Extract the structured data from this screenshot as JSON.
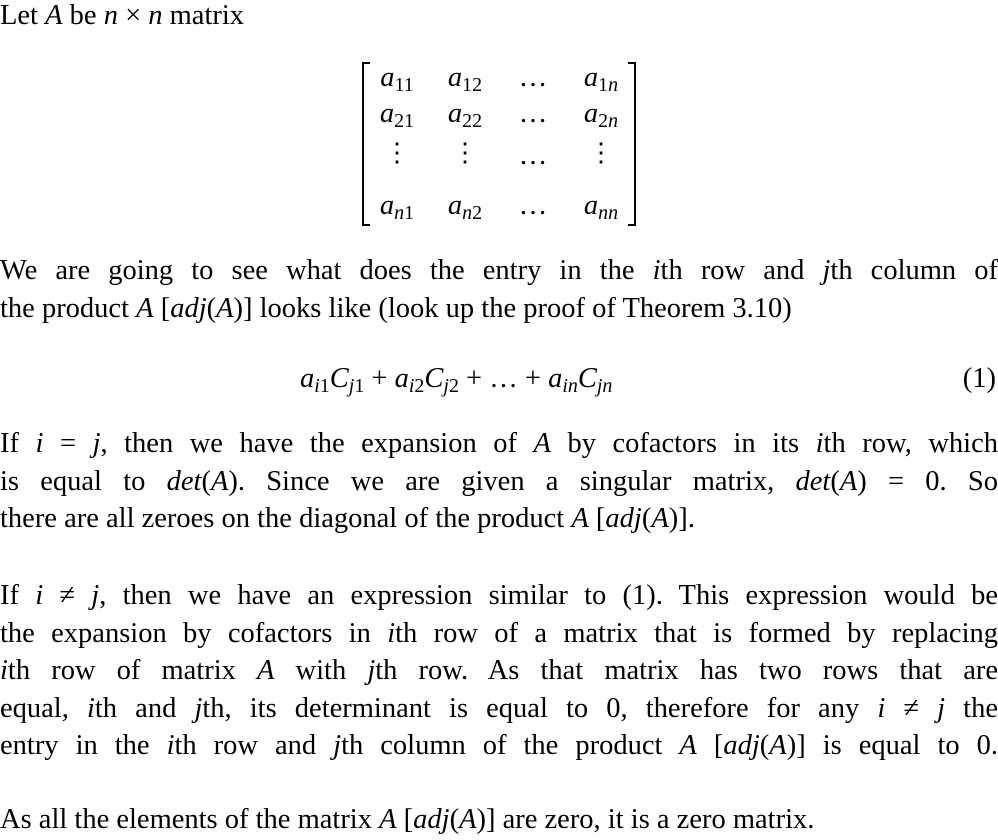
{
  "intro": [
    {
      "t": "Let ",
      "i": false
    },
    {
      "t": "A",
      "i": true
    },
    {
      "t": " be ",
      "i": false
    },
    {
      "t": "n",
      "i": true
    },
    {
      "t": " × ",
      "i": false
    },
    {
      "t": "n",
      "i": true
    },
    {
      "t": " matrix",
      "i": false
    }
  ],
  "matrix": {
    "rows": [
      [
        {
          "b": "a",
          "s": "11"
        },
        {
          "b": "a",
          "s": "12"
        },
        {
          "b": "…",
          "s": ""
        },
        {
          "b": "a",
          "s": "1n"
        }
      ],
      [
        {
          "b": "a",
          "s": "21"
        },
        {
          "b": "a",
          "s": "22"
        },
        {
          "b": "…",
          "s": ""
        },
        {
          "b": "a",
          "s": "2n"
        }
      ],
      [
        {
          "b": "⋮",
          "s": ""
        },
        {
          "b": "⋮",
          "s": ""
        },
        {
          "b": "…",
          "s": ""
        },
        {
          "b": "⋮",
          "s": ""
        }
      ],
      [
        {
          "b": "a",
          "s": "n1"
        },
        {
          "b": "a",
          "s": "n2"
        },
        {
          "b": "…",
          "s": ""
        },
        {
          "b": "a",
          "s": "nn"
        }
      ]
    ]
  },
  "para1": [
    [
      {
        "t": "We are going to see what does the entry in the ",
        "i": false
      },
      {
        "t": "i",
        "i": true
      },
      {
        "t": "th row and ",
        "i": false
      },
      {
        "t": "j",
        "i": true
      },
      {
        "t": "th column of",
        "i": false
      }
    ],
    [
      {
        "t": "the product ",
        "i": false
      },
      {
        "t": "A",
        "i": true
      },
      {
        "t": " [",
        "i": false
      },
      {
        "t": "adj",
        "i": true
      },
      {
        "t": "(",
        "i": false
      },
      {
        "t": "A",
        "i": true
      },
      {
        "t": ")] looks like (look up the proof of Theorem 3.10)",
        "i": false
      }
    ]
  ],
  "equation": {
    "terms": [
      {
        "b": "a",
        "s": "i1"
      },
      {
        "b": "C",
        "s": "j1"
      },
      {
        "op": " + "
      },
      {
        "b": "a",
        "s": "i2"
      },
      {
        "b": "C",
        "s": "j2"
      },
      {
        "op": " + … + "
      },
      {
        "b": "a",
        "s": "in"
      },
      {
        "b": "C",
        "s": "jn"
      }
    ],
    "number": "(1)"
  },
  "para2": [
    [
      {
        "t": "If ",
        "i": false
      },
      {
        "t": "i",
        "i": true
      },
      {
        "t": " = ",
        "i": false
      },
      {
        "t": "j",
        "i": true
      },
      {
        "t": ", then we have the expansion of ",
        "i": false
      },
      {
        "t": "A",
        "i": true
      },
      {
        "t": " by cofactors in its ",
        "i": false
      },
      {
        "t": "i",
        "i": true
      },
      {
        "t": "th row, which",
        "i": false
      }
    ],
    [
      {
        "t": "is equal to ",
        "i": false
      },
      {
        "t": "det",
        "i": true
      },
      {
        "t": "(",
        "i": false
      },
      {
        "t": "A",
        "i": true
      },
      {
        "t": ").  Since we are given a singular matrix, ",
        "i": false
      },
      {
        "t": "det",
        "i": true
      },
      {
        "t": "(",
        "i": false
      },
      {
        "t": "A",
        "i": true
      },
      {
        "t": ") = 0.  So",
        "i": false
      }
    ],
    [
      {
        "t": "there are all zeroes on the diagonal of the product ",
        "i": false
      },
      {
        "t": "A",
        "i": true
      },
      {
        "t": " [",
        "i": false
      },
      {
        "t": "adj",
        "i": true
      },
      {
        "t": "(",
        "i": false
      },
      {
        "t": "A",
        "i": true
      },
      {
        "t": ")].",
        "i": false
      }
    ]
  ],
  "para3": [
    [
      {
        "t": "If ",
        "i": false
      },
      {
        "t": "i",
        "i": true
      },
      {
        "t": " ≠ ",
        "i": false
      },
      {
        "t": "j",
        "i": true
      },
      {
        "t": ", then we have an expression similar to (1).  This expression would be",
        "i": false
      }
    ],
    [
      {
        "t": "the expansion by cofactors in ",
        "i": false
      },
      {
        "t": "i",
        "i": true
      },
      {
        "t": "th row of a matrix that is formed by replacing",
        "i": false
      }
    ],
    [
      {
        "t": "i",
        "i": true
      },
      {
        "t": "th row of matrix ",
        "i": false
      },
      {
        "t": "A",
        "i": true
      },
      {
        "t": " with ",
        "i": false
      },
      {
        "t": "j",
        "i": true
      },
      {
        "t": "th row.  As that matrix has two rows that are",
        "i": false
      }
    ],
    [
      {
        "t": "equal, ",
        "i": false
      },
      {
        "t": "i",
        "i": true
      },
      {
        "t": "th and ",
        "i": false
      },
      {
        "t": "j",
        "i": true
      },
      {
        "t": "th, its determinant is equal to 0, therefore for any ",
        "i": false
      },
      {
        "t": "i",
        "i": true
      },
      {
        "t": " ≠ ",
        "i": false
      },
      {
        "t": "j",
        "i": true
      },
      {
        "t": " the",
        "i": false
      }
    ],
    [
      {
        "t": "entry in the ",
        "i": false
      },
      {
        "t": "i",
        "i": true
      },
      {
        "t": "th row and ",
        "i": false
      },
      {
        "t": "j",
        "i": true
      },
      {
        "t": "th column of the product ",
        "i": false
      },
      {
        "t": "A",
        "i": true
      },
      {
        "t": " [",
        "i": false
      },
      {
        "t": "adj",
        "i": true
      },
      {
        "t": "(",
        "i": false
      },
      {
        "t": "A",
        "i": true
      },
      {
        "t": ")] is equal to 0.",
        "i": false
      }
    ]
  ],
  "para4": [
    [
      {
        "t": "As all the elements of the matrix ",
        "i": false
      },
      {
        "t": "A",
        "i": true
      },
      {
        "t": " [",
        "i": false
      },
      {
        "t": "adj",
        "i": true
      },
      {
        "t": "(",
        "i": false
      },
      {
        "t": "A",
        "i": true
      },
      {
        "t": ")] are zero, it is a zero matrix.",
        "i": false
      }
    ]
  ]
}
